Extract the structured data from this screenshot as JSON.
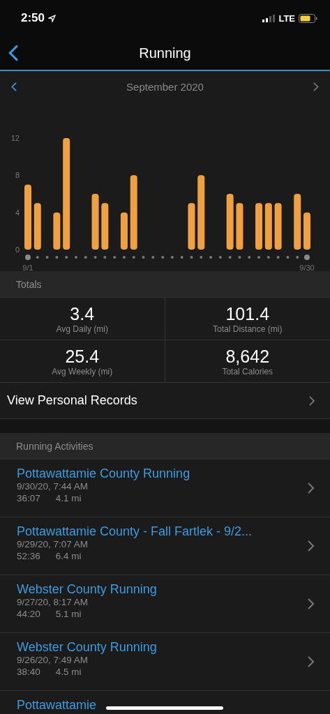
{
  "status_bar": {
    "time": "2:50",
    "network": "LTE"
  },
  "nav": {
    "title": "Running"
  },
  "period": {
    "label": "September 2020"
  },
  "chart_data": {
    "type": "bar",
    "categories": [
      "9/1",
      null,
      null,
      null,
      null,
      null,
      null,
      null,
      null,
      null,
      null,
      null,
      null,
      null,
      null,
      null,
      null,
      null,
      null,
      null,
      null,
      null,
      null,
      null,
      null,
      null,
      null,
      null,
      null,
      "9/30"
    ],
    "series": [
      {
        "color": "#f0a040",
        "values": [
          7,
          5,
          0,
          4,
          12,
          0,
          0,
          6,
          5,
          0,
          4,
          8,
          0,
          0,
          0,
          0,
          0,
          5,
          8,
          0,
          0,
          6,
          5,
          0,
          5,
          5,
          5,
          0,
          6,
          4
        ]
      }
    ],
    "ylim": [
      0,
      12
    ],
    "yticks": [
      0,
      4,
      8,
      12
    ]
  },
  "totals": {
    "title": "Totals",
    "stats": [
      {
        "value": "3.4",
        "label": "Avg Daily (mi)"
      },
      {
        "value": "101.4",
        "label": "Total Distance (mi)"
      },
      {
        "value": "25.4",
        "label": "Avg Weekly (mi)"
      },
      {
        "value": "8,642",
        "label": "Total Calories"
      }
    ]
  },
  "records_link": {
    "label": "View Personal Records"
  },
  "activities": {
    "title": "Running Activities",
    "items": [
      {
        "name": "Pottawattamie County Running",
        "date": "9/30/20, 7:44 AM",
        "duration": "36:07",
        "distance": "4.1 mi"
      },
      {
        "name": "Pottawattamie County - Fall Fartlek - 9/2...",
        "date": "9/29/20, 7:07 AM",
        "duration": "52:36",
        "distance": "6.4 mi"
      },
      {
        "name": "Webster County Running",
        "date": "9/27/20, 8:17 AM",
        "duration": "44:20",
        "distance": "5.1 mi"
      },
      {
        "name": "Webster County Running",
        "date": "9/26/20, 7:49 AM",
        "duration": "38:40",
        "distance": "4.5 mi"
      },
      {
        "name": "Pottawattamie"
      }
    ]
  }
}
